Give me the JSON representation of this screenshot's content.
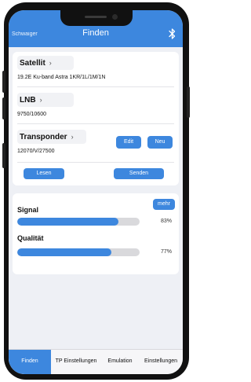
{
  "nav": {
    "back_label": "Schwaiger",
    "title": "Finden",
    "bluetooth_icon": "bluetooth-icon"
  },
  "satellite": {
    "label": "Satellit",
    "value": "19.2E Ku-band Astra 1KR/1L/1M/1N"
  },
  "lnb": {
    "label": "LNB",
    "value": "9750/10600"
  },
  "transponder": {
    "label": "Transponder",
    "value": "12070/V/27500",
    "edit_label": "Edit",
    "new_label": "Neu"
  },
  "actions": {
    "read_label": "Lesen",
    "send_label": "Senden"
  },
  "signal": {
    "more_label": "mehr",
    "signal_label": "Signal",
    "signal_value": 0.83,
    "signal_pct": "83%",
    "quality_label": "Qualität",
    "quality_value": 0.77,
    "quality_pct": "77%"
  },
  "tabs": [
    {
      "label": "Finden",
      "active": true
    },
    {
      "label": "TP Einstellungen",
      "active": false
    },
    {
      "label": "Emulation",
      "active": false
    },
    {
      "label": "Einstellungen",
      "active": false
    }
  ],
  "colors": {
    "accent": "#3d87de",
    "track": "#d9d9dc",
    "background": "#eef0f5"
  }
}
